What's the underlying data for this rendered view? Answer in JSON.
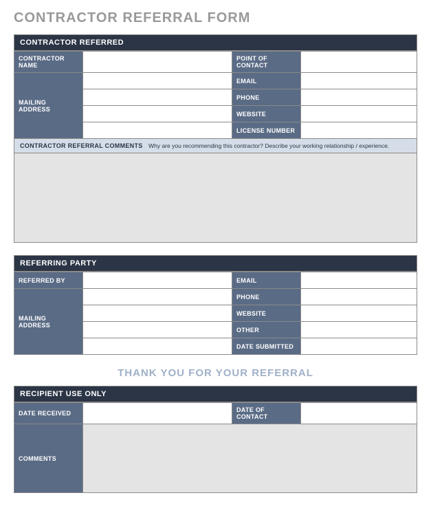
{
  "title": "CONTRACTOR REFERRAL FORM",
  "section1": {
    "header": "CONTRACTOR REFERRED",
    "rows": {
      "contractor_name": "CONTRACTOR NAME",
      "mailing_address": "MAILING ADDRESS",
      "point_of_contact": "POINT OF CONTACT",
      "email": "EMAIL",
      "phone": "PHONE",
      "website": "WEBSITE",
      "license_number": "LICENSE NUMBER"
    },
    "values": {
      "contractor_name": "",
      "mailing_address_1": "",
      "mailing_address_2": "",
      "mailing_address_3": "",
      "mailing_address_4": "",
      "point_of_contact": "",
      "email": "",
      "phone": "",
      "website": "",
      "license_number": ""
    },
    "comments_label": "CONTRACTOR REFERRAL COMMENTS",
    "comments_hint": "Why are you recommending this contractor? Describe your working relationship / experience.",
    "comments_value": ""
  },
  "section2": {
    "header": "REFERRING PARTY",
    "rows": {
      "referred_by": "REFERRED BY",
      "mailing_address": "MAILING ADDRESS",
      "email": "EMAIL",
      "phone": "PHONE",
      "website": "WEBSITE",
      "other": "OTHER",
      "date_submitted": "DATE SUBMITTED"
    },
    "values": {
      "referred_by": "",
      "mailing_address_1": "",
      "mailing_address_2": "",
      "mailing_address_3": "",
      "mailing_address_4": "",
      "email": "",
      "phone": "",
      "website": "",
      "other": "",
      "date_submitted": ""
    }
  },
  "thank_you": "THANK YOU FOR YOUR REFERRAL",
  "section3": {
    "header": "RECIPIENT USE ONLY",
    "rows": {
      "date_received": "DATE RECEIVED",
      "date_of_contact": "DATE OF CONTACT",
      "comments": "COMMENTS"
    },
    "values": {
      "date_received": "",
      "date_of_contact": "",
      "comments": ""
    }
  }
}
